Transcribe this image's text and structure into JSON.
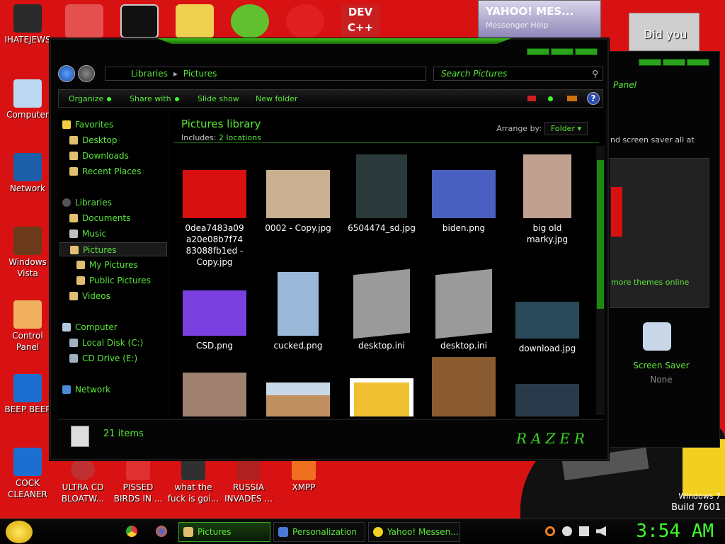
{
  "desktop": {
    "top_icons": [
      {
        "label": "IHATEJEWS",
        "color": "#2a2a2a"
      },
      {
        "label": "",
        "color": "#e45050"
      },
      {
        "label": "",
        "color": "#111111"
      },
      {
        "label": "",
        "color": "#f0d050"
      },
      {
        "label": "",
        "color": "#60c030"
      },
      {
        "label": "",
        "color": "#e02020"
      },
      {
        "label": "",
        "color": "#c82020"
      }
    ],
    "left_icons": [
      {
        "label": "Computer",
        "color": "#bcd8f0"
      },
      {
        "label": "Network",
        "color": "#1d5ea8"
      },
      {
        "label": "Windows Vista",
        "color": "#6b3a1a"
      },
      {
        "label": "Control Panel",
        "color": "#f0b060"
      },
      {
        "label": "BEEP BEEP",
        "color": "#1c6fd0"
      },
      {
        "label": "COCK CLEANER",
        "color": "#1c6fd0"
      }
    ],
    "bottom_icons": [
      {
        "label": "ULTRA CD BLOATW...",
        "color": "#c03030"
      },
      {
        "label": "PISSED BIRDS IN ...",
        "color": "#e03030"
      },
      {
        "label": "what the fuck is goi...",
        "color": "#303030"
      },
      {
        "label": "RUSSIA INVADES ...",
        "color": "#b02020"
      },
      {
        "label": "XMPP",
        "color": "#f07020"
      }
    ],
    "watermark_line1": "Windows 7",
    "watermark_line2": "Build 7601"
  },
  "explorer": {
    "breadcrumb": [
      "Libraries",
      "Pictures"
    ],
    "search_placeholder": "Search Pictures",
    "commands": [
      "Organize",
      "Share with",
      "Slide show",
      "New folder"
    ],
    "help_label": "?",
    "sidebar": {
      "favorites_header": "Favorites",
      "favorites": [
        "Desktop",
        "Downloads",
        "Recent Places"
      ],
      "libraries_header": "Libraries",
      "libraries": [
        "Documents",
        "Music",
        "Pictures",
        "My Pictures",
        "Public Pictures",
        "Videos"
      ],
      "computer_header": "Computer",
      "drives": [
        "Local Disk (C:)",
        "CD Drive (E:)"
      ],
      "network_header": "Network"
    },
    "library_title": "Pictures library",
    "includes_label": "Includes:",
    "includes_value": "2 locations",
    "arrange_label": "Arrange by:",
    "arrange_value": "Folder",
    "files": [
      {
        "name": "0dea7483a09a20e08b7f7483088fb1ed - Copy.jpg",
        "color": "#d81010"
      },
      {
        "name": "0002 - Copy.jpg",
        "color": "#c8b090"
      },
      {
        "name": "6504474_sd.jpg",
        "color": "#2a3a3a"
      },
      {
        "name": "biden.png",
        "color": "#4a60c0"
      },
      {
        "name": "big old marky.jpg",
        "color": "#c0a090"
      },
      {
        "name": "CSD.png",
        "color": "#7a40e0"
      },
      {
        "name": "cucked.png",
        "color": "#9ab8d8"
      },
      {
        "name": "desktop.ini",
        "color": "#9a9a9a"
      },
      {
        "name": "desktop.ini",
        "color": "#9a9a9a"
      },
      {
        "name": "download.jpg",
        "color": "#2a4a5a"
      },
      {
        "name": "",
        "color": "#a08070"
      },
      {
        "name": "",
        "color": "#c09060"
      },
      {
        "name": "",
        "color": "#f0c030"
      },
      {
        "name": "",
        "color": "#8a5a30"
      },
      {
        "name": "",
        "color": "#2a3a4a"
      }
    ],
    "item_count": "21 items",
    "brand": "RAZER"
  },
  "personalization": {
    "panel_title": "Panel",
    "text_snippet": "nd screen saver all at",
    "more_themes": "more themes online",
    "screen_saver_label": "Screen Saver",
    "screen_saver_value": "None"
  },
  "yahoo": {
    "title": "YAHOO! MES...",
    "menu": "Messenger    Help"
  },
  "didyou": "Did you",
  "taskbar": {
    "buttons": [
      {
        "label": "Pictures",
        "color": "#e0c070"
      },
      {
        "label": "Personalization",
        "color": "#4a7ad8"
      },
      {
        "label": "Yahoo! Messen...",
        "color": "#f0d020"
      }
    ],
    "clock": "3:54 AM"
  },
  "colors": {
    "accent_green": "#59e63a",
    "desktop_red": "#d81212"
  }
}
